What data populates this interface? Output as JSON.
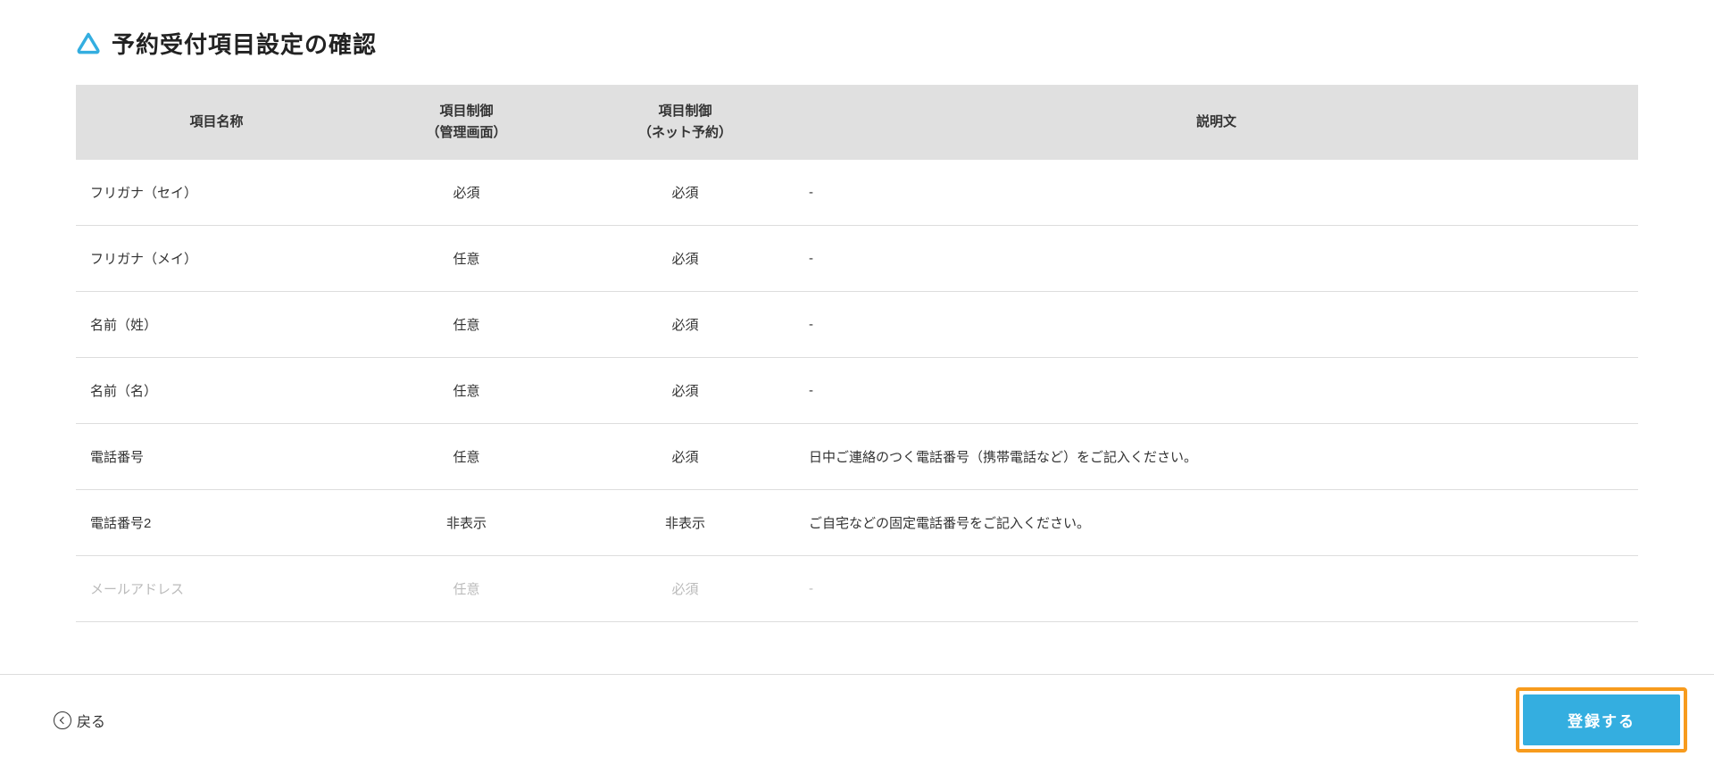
{
  "header": {
    "title": "予約受付項目設定の確認"
  },
  "table": {
    "columns": {
      "name": "項目名称",
      "admin_l1": "項目制御",
      "admin_l2": "（管理画面）",
      "net_l1": "項目制御",
      "net_l2": "（ネット予約）",
      "desc": "説明文"
    },
    "rows": [
      {
        "name": "フリガナ（セイ）",
        "admin": "必須",
        "net": "必須",
        "desc": "-"
      },
      {
        "name": "フリガナ（メイ）",
        "admin": "任意",
        "net": "必須",
        "desc": "-"
      },
      {
        "name": "名前（姓）",
        "admin": "任意",
        "net": "必須",
        "desc": "-"
      },
      {
        "name": "名前（名）",
        "admin": "任意",
        "net": "必須",
        "desc": "-"
      },
      {
        "name": "電話番号",
        "admin": "任意",
        "net": "必須",
        "desc": "日中ご連絡のつく電話番号（携帯電話など）をご記入ください。"
      },
      {
        "name": "電話番号2",
        "admin": "非表示",
        "net": "非表示",
        "desc": "ご自宅などの固定電話番号をご記入ください。"
      },
      {
        "name": "メールアドレス",
        "admin": "任意",
        "net": "必須",
        "desc": "-"
      }
    ]
  },
  "footer": {
    "back_label": "戻る",
    "register_label": "登録する"
  },
  "colors": {
    "accent": "#34aee0",
    "highlight": "#f79b1d"
  }
}
